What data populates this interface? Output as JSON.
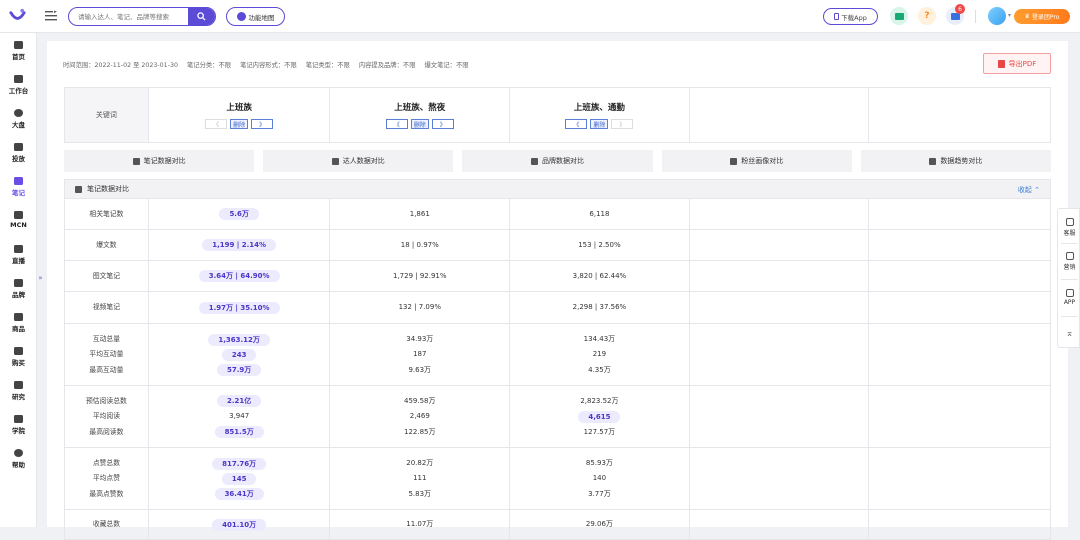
{
  "header": {
    "search_placeholder": "请输入达人、笔记、品牌等搜索",
    "func_map": "功能地图",
    "download_app": "下载App",
    "notification_count": "6",
    "help_icon_text": "?",
    "vip_label": "登录团Pro"
  },
  "sidebar": {
    "items": [
      {
        "label": "首页"
      },
      {
        "label": "工作台"
      },
      {
        "label": "大盘"
      },
      {
        "label": "投放"
      },
      {
        "label": "笔记"
      },
      {
        "label": "MCN"
      },
      {
        "label": "直播"
      },
      {
        "label": "品牌"
      },
      {
        "label": "商品"
      },
      {
        "label": "购买"
      },
      {
        "label": "研究"
      },
      {
        "label": "学院"
      },
      {
        "label": "帮助"
      }
    ],
    "expand_glyph": "»"
  },
  "filters": [
    "时间范围：2022-11-02 至 2023-01-30",
    "笔记分类：不限",
    "笔记内容形式：不限",
    "笔记类型：不限",
    "内容提及品牌：不限",
    "爆文笔记：不限"
  ],
  "export_pdf": "导出PDF",
  "keywords": {
    "header": "关键词",
    "delete_label": "删除",
    "prev_glyph": "《",
    "next_glyph": "》",
    "columns": [
      {
        "name": "上班族"
      },
      {
        "name": "上班族、熬夜"
      },
      {
        "name": "上班族、通勤"
      }
    ]
  },
  "tabs": [
    "笔记数据对比",
    "达人数据对比",
    "品牌数据对比",
    "粉丝画像对比",
    "数据趋势对比"
  ],
  "section": {
    "title": "笔记数据对比",
    "collapse": "收起 ⌃"
  },
  "rows": [
    {
      "labels": [
        "相关笔记数"
      ],
      "c1": [
        {
          "v": "5.6万",
          "hl": true
        }
      ],
      "c2": [
        {
          "v": "1,861"
        }
      ],
      "c3": [
        {
          "v": "6,118"
        }
      ]
    },
    {
      "labels": [
        "爆文数"
      ],
      "c1": [
        {
          "v": "1,199 | 2.14%",
          "hl": true
        }
      ],
      "c2": [
        {
          "v": "18 | 0.97%"
        }
      ],
      "c3": [
        {
          "v": "153 | 2.50%"
        }
      ]
    },
    {
      "labels": [
        "图文笔记"
      ],
      "c1": [
        {
          "v": "3.64万 | 64.90%",
          "hl": true
        }
      ],
      "c2": [
        {
          "v": "1,729 | 92.91%"
        }
      ],
      "c3": [
        {
          "v": "3,820 | 62.44%"
        }
      ]
    },
    {
      "labels": [
        "视频笔记"
      ],
      "c1": [
        {
          "v": "1.97万 | 35.10%",
          "hl": true
        }
      ],
      "c2": [
        {
          "v": "132 | 7.09%"
        }
      ],
      "c3": [
        {
          "v": "2,298 | 37.56%"
        }
      ]
    },
    {
      "labels": [
        "互动总量",
        "平均互动量",
        "最高互动量"
      ],
      "c1": [
        {
          "v": "1,363.12万",
          "hl": true
        },
        {
          "v": "243",
          "hl": true
        },
        {
          "v": "57.9万",
          "hl": true
        }
      ],
      "c2": [
        {
          "v": "34.93万"
        },
        {
          "v": "187"
        },
        {
          "v": "9.63万"
        }
      ],
      "c3": [
        {
          "v": "134.43万"
        },
        {
          "v": "219"
        },
        {
          "v": "4.35万"
        }
      ]
    },
    {
      "labels": [
        "预估阅读总数",
        "平均阅读",
        "最高阅读数"
      ],
      "c1": [
        {
          "v": "2.21亿",
          "hl": true
        },
        {
          "v": "3,947"
        },
        {
          "v": "851.5万",
          "hl": true
        }
      ],
      "c2": [
        {
          "v": "459.58万"
        },
        {
          "v": "2,469"
        },
        {
          "v": "122.85万"
        }
      ],
      "c3": [
        {
          "v": "2,823.52万"
        },
        {
          "v": "4,615",
          "hl": true
        },
        {
          "v": "127.57万"
        }
      ]
    },
    {
      "labels": [
        "点赞总数",
        "平均点赞",
        "最高点赞数"
      ],
      "c1": [
        {
          "v": "817.76万",
          "hl": true
        },
        {
          "v": "145",
          "hl": true
        },
        {
          "v": "36.41万",
          "hl": true
        }
      ],
      "c2": [
        {
          "v": "20.82万"
        },
        {
          "v": "111"
        },
        {
          "v": "5.83万"
        }
      ],
      "c3": [
        {
          "v": "85.93万"
        },
        {
          "v": "140"
        },
        {
          "v": "3.77万"
        }
      ]
    },
    {
      "labels": [
        "收藏总数"
      ],
      "c1": [
        {
          "v": "401.10万",
          "hl": true
        }
      ],
      "c2": [
        {
          "v": "11.07万"
        }
      ],
      "c3": [
        {
          "v": "29.06万"
        }
      ]
    }
  ],
  "float_bar": [
    "客服",
    "营销",
    "APP"
  ],
  "colors": {
    "accent": "#5b4bd6",
    "highlight_bg": "#eceafd",
    "pdf_red": "#e84646",
    "vip_orange": "#ff8a24"
  }
}
